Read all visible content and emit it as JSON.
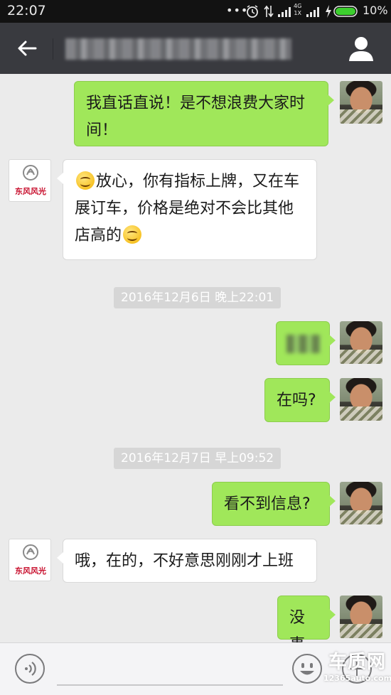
{
  "status_bar": {
    "time": "22:07",
    "network_type": "4G",
    "network_sub": "1X",
    "battery_percent": "10%"
  },
  "header": {
    "title": "",
    "title_blurred": true,
    "back_icon": "arrow-left-icon",
    "profile_icon": "person-icon"
  },
  "messages": [
    {
      "direction": "out",
      "text": "我直话直说！是不想浪费大家时间！"
    },
    {
      "direction": "in",
      "sender_logo_text": "东风风光",
      "parts": [
        "放心，你有指标上牌，又在车展订车，价格是绝对不会比其他店高的"
      ],
      "emoji_start": true,
      "emoji_end": true
    },
    {
      "type": "timestamp",
      "text": "2016年12月6日 晚上22:01"
    },
    {
      "direction": "out",
      "blurred": true
    },
    {
      "direction": "out",
      "text": "在吗?"
    },
    {
      "type": "timestamp",
      "text": "2016年12月7日 早上09:52"
    },
    {
      "direction": "out",
      "text": "看不到信息?"
    },
    {
      "direction": "in",
      "sender_logo_text": "东风风光",
      "text": "哦，在的，不好意思刚刚才上班"
    },
    {
      "direction": "out",
      "text": "没事"
    }
  ],
  "input_bar": {
    "voice_icon": "voice-icon",
    "emoji_icon": "emoji-icon",
    "plus_icon": "plus-icon"
  },
  "watermark": {
    "main": "车质网",
    "sub": "12365auto.com"
  },
  "colors": {
    "header_bg": "#393a3f",
    "outgoing_bubble": "#a0e75a",
    "incoming_bubble": "#ffffff",
    "chat_bg": "#ebebeb",
    "logo_red": "#c8102e"
  }
}
